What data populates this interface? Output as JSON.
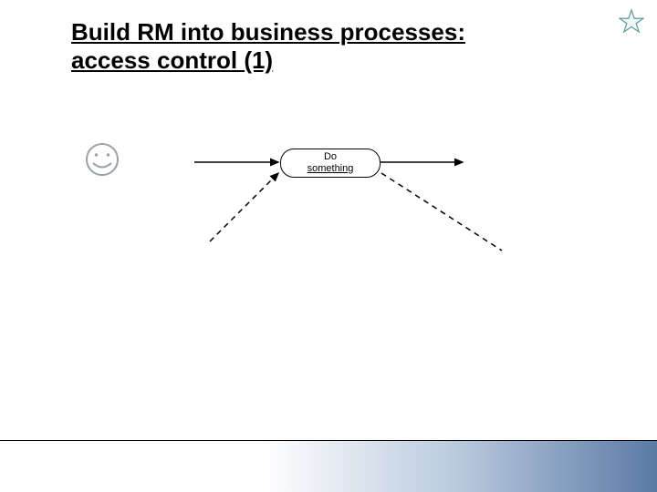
{
  "title": "Build RM into business processes: access control (1)",
  "process": {
    "line1": "Do",
    "line2": "something"
  },
  "icons": {
    "star": "star-icon",
    "smiley": "smiley-icon"
  },
  "colors": {
    "star_stroke": "#6aa0a0",
    "star_fill": "#eef6f6",
    "smiley_stroke": "#9aa1ac",
    "footer_grad_from": "#ffffff",
    "footer_grad_to": "#5a7aa6"
  }
}
